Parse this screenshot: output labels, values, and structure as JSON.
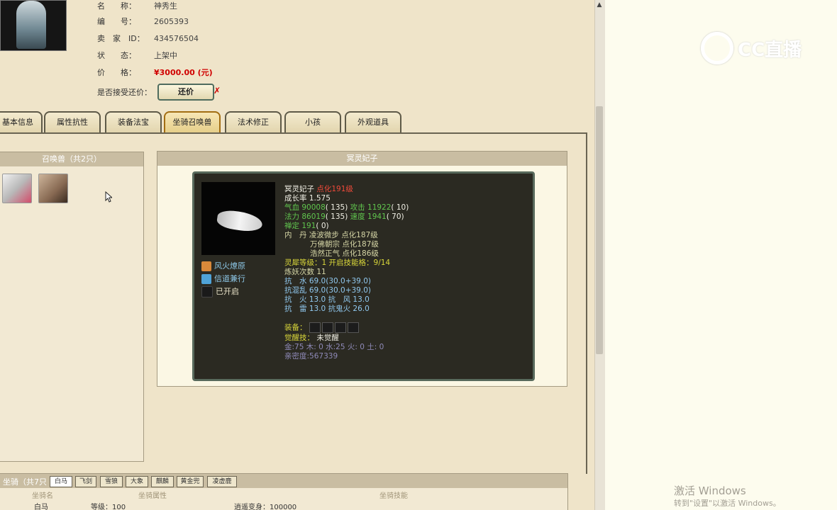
{
  "seller_info": {
    "rows": [
      {
        "label": "名　　称：",
        "value": "神秀生"
      },
      {
        "label": "编　　号：",
        "value": "2605393"
      },
      {
        "label": "卖　家　ID：",
        "value": "434576504"
      },
      {
        "label": "状　　态：",
        "value": "上架中"
      },
      {
        "label": "价　　格：",
        "value": "¥3000.00 (元)"
      }
    ],
    "counter_offer_label": "是否接受还价：",
    "counter_offer_button": "还价",
    "counter_offer_mark": "✗"
  },
  "tabs": [
    {
      "label": "基本信息",
      "active": false
    },
    {
      "label": "属性抗性",
      "active": false
    },
    {
      "label": "装备法宝",
      "active": false
    },
    {
      "label": "坐骑召唤兽",
      "active": true
    },
    {
      "label": "法术修正",
      "active": false
    },
    {
      "label": "小孩",
      "active": false
    },
    {
      "label": "外观道具",
      "active": false
    }
  ],
  "summon_panel": {
    "title": "召唤兽（共2只）"
  },
  "pet_detail": {
    "title": "冥灵妃子",
    "name": "冥灵妃子",
    "level": "点化191级",
    "growth": "成长率 1.575",
    "hp_label": "气血",
    "hp": "90008",
    "hp_pt": "( 135)",
    "atk_label": "攻击",
    "atk": "11922",
    "atk_pt": "( 10)",
    "mp_label": "法力",
    "mp": "86019",
    "mp_pt": "( 135)",
    "spd_label": "速度",
    "spd": "1941",
    "spd_pt": "( 70)",
    "focus_label": "禅定",
    "focus": "191",
    "focus_pt": "( 0)",
    "neidan_label": "内　丹",
    "neidan": [
      {
        "name": "凌波微步",
        "level": "点化187级"
      },
      {
        "name": "万佛朝宗",
        "level": "点化187级"
      },
      {
        "name": "浩然正气",
        "level": "点化186级"
      }
    ],
    "spirit_label": "灵犀等级",
    "spirit_level": "：1 开启技能格：9/14",
    "refine": "炼妖次数 11",
    "res_water": {
      "label": "抗　水",
      "value": "69.0(30.0+39.0)"
    },
    "res_chaos": {
      "label": "抗混乱",
      "value": "69.0(30.0+39.0)"
    },
    "res_fire": {
      "label": "抗　火",
      "value": "13.0"
    },
    "res_wind": {
      "label": "抗　风",
      "value": "13.0"
    },
    "res_thunder": {
      "label": "抗　雷",
      "value": "13.0"
    },
    "res_ghost": {
      "label": "抗鬼火",
      "value": "26.0"
    },
    "equip_label": "装备：",
    "awaken_label": "觉醒技：",
    "awaken_value": "未觉醒",
    "elements": "金:75 木: 0 水:25 火: 0 土: 0",
    "intimacy": "亲密度:567339",
    "skills": [
      {
        "name": "风火燎原",
        "icon": "fire-skill-icon"
      },
      {
        "name": "信道兼行",
        "icon": "wing-skill-icon"
      },
      {
        "name": "已开启",
        "icon": "blank-skill-icon"
      }
    ]
  },
  "mount_panel": {
    "label": "坐骑（共7只",
    "tabs": [
      "白马",
      "飞剑",
      "雪狼",
      "大象",
      "麒麟",
      "黄金兜",
      "凌虚鹿"
    ],
    "active_tab": 0,
    "columns": [
      "坐骑名",
      "坐骑属性",
      "坐骑技能"
    ],
    "row": {
      "name": "白马",
      "attr": "等级：100",
      "skill": "逍遥变身：100000"
    }
  },
  "watermark": {
    "cc_text": "CC直播",
    "win_title": "激活 Windows",
    "win_sub": "转到\"设置\"以激活 Windows。"
  },
  "colors": {
    "accent": "#a26d12",
    "price": "#d00000",
    "card_bg": "#2b2a22"
  }
}
